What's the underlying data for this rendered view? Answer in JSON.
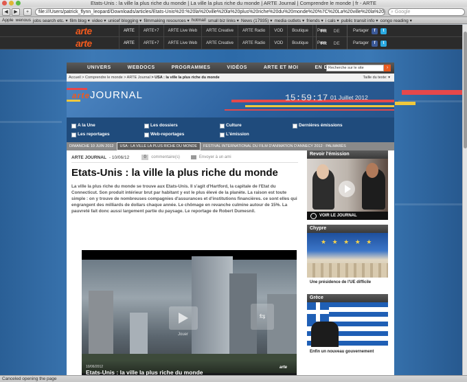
{
  "browser": {
    "title": "Etats-Unis : la ville la plus riche du monde | La ville la plus riche du monde | ARTE Journal | Comprendre le monde | fr - ARTE",
    "url": "file:///Users/patrick_flynn_leopard/Downloads/articles/Etats-Unis%20:%20la%20ville%20la%20plus%20riche%20du%20monde%20%7C%20La%20ville%20la%20plus%20ric",
    "search_placeholder": "Google",
    "back_label": "◀",
    "forward_label": "▶",
    "add_label": "+",
    "bookmarks": [
      "Apple",
      "wenous",
      "jobs search etc. ▾",
      "film blog ▾",
      "video ▾",
      "unicef blogging ▾",
      "filmmaking resources ▾",
      "hotmail",
      "small biz links ▾",
      "News (17935) ▾",
      "media outlets ▾",
      "friends ▾",
      "i cals ▾",
      "public transit info ▾",
      "congo reading ▾"
    ],
    "status": "Canceled opening the page"
  },
  "arte_header": {
    "logo": "arte",
    "nav": [
      "ARTE",
      "ARTE+7",
      "ARTE Live Web",
      "ARTE Creative",
      "ARTE Radio",
      "VOD",
      "Boutique",
      "Pro"
    ],
    "lang_fr": "FR",
    "lang_de": "DE",
    "share_label": "Partager"
  },
  "main_nav": {
    "items": [
      "UNIVERS",
      "WEBDOCS",
      "PROGRAMMES",
      "VIDÉOS",
      "ARTE ET MOI",
      "EN DIRECT"
    ],
    "search_placeholder": "Recherche sur le site"
  },
  "breadcrumb": {
    "path": "Accueil > Comprendre le monde > ARTE Journal",
    "current": "> USA : la ville la plus riche du monde",
    "text_size": "Taille du texte: ▾"
  },
  "journal": {
    "logo_arte": "arte",
    "logo_word": "JOURNAL",
    "clock": "15:59:17",
    "date": "01 Juillet 2012"
  },
  "subnav": {
    "items": [
      "A la Une",
      "Les dossiers",
      "Culture",
      "Dernières émissions",
      "Les reportages",
      "Web-reportages",
      "L'émission"
    ]
  },
  "ticker": {
    "items": [
      "DIMANCHE 10 JUIN 2012",
      "USA : LA VILLE LA PLUS RICHE DU MONDE",
      "FESTIVAL INTERNATIONAL DU FILM D'ANIMATION D'ANNECY 2012 : PALMARÈS"
    ]
  },
  "article": {
    "source": "ARTE JOURNAL",
    "date": "- 10/06/12",
    "comment_count": "0",
    "comments_label": "commentaire(s)",
    "send_label": "Envoyer à un ami",
    "headline": "Etats-Unis : la ville la plus riche du monde",
    "lede": "La ville la plus riche du monde se trouve aux Etats-Unis. Il s'agit d'Hartford, la capitale de l'Etat du Connecticut. Son produit intérieur brut par habitant y est le plus élevé de la planète. La raison est toute simple : on y trouve de nombreuses compagnies d'assurances et d'institutions financières. ce sont elles qui engrangent des milliards de dollars chaque année. Le chômage en revanche culmine autour de 15%. La pauvreté fait donc aussi largement partie du paysage. Le reportage de Robert Dumesnil."
  },
  "video": {
    "date": "10/06/2012",
    "title": "Etats-Unis : la ville la plus riche du monde",
    "logo": "arte",
    "play_label": "Jouer",
    "share_symbol": "⇆"
  },
  "sidebar": {
    "revoir": {
      "heading": "Revoir l'émission",
      "cta": "VOIR LE JOURNAL"
    },
    "chypre": {
      "heading": "Chypre",
      "caption": "Une présidence de l'UE difficile"
    },
    "grece": {
      "heading": "Grèce",
      "caption": "Enfin un nouveau gouvernement"
    }
  }
}
